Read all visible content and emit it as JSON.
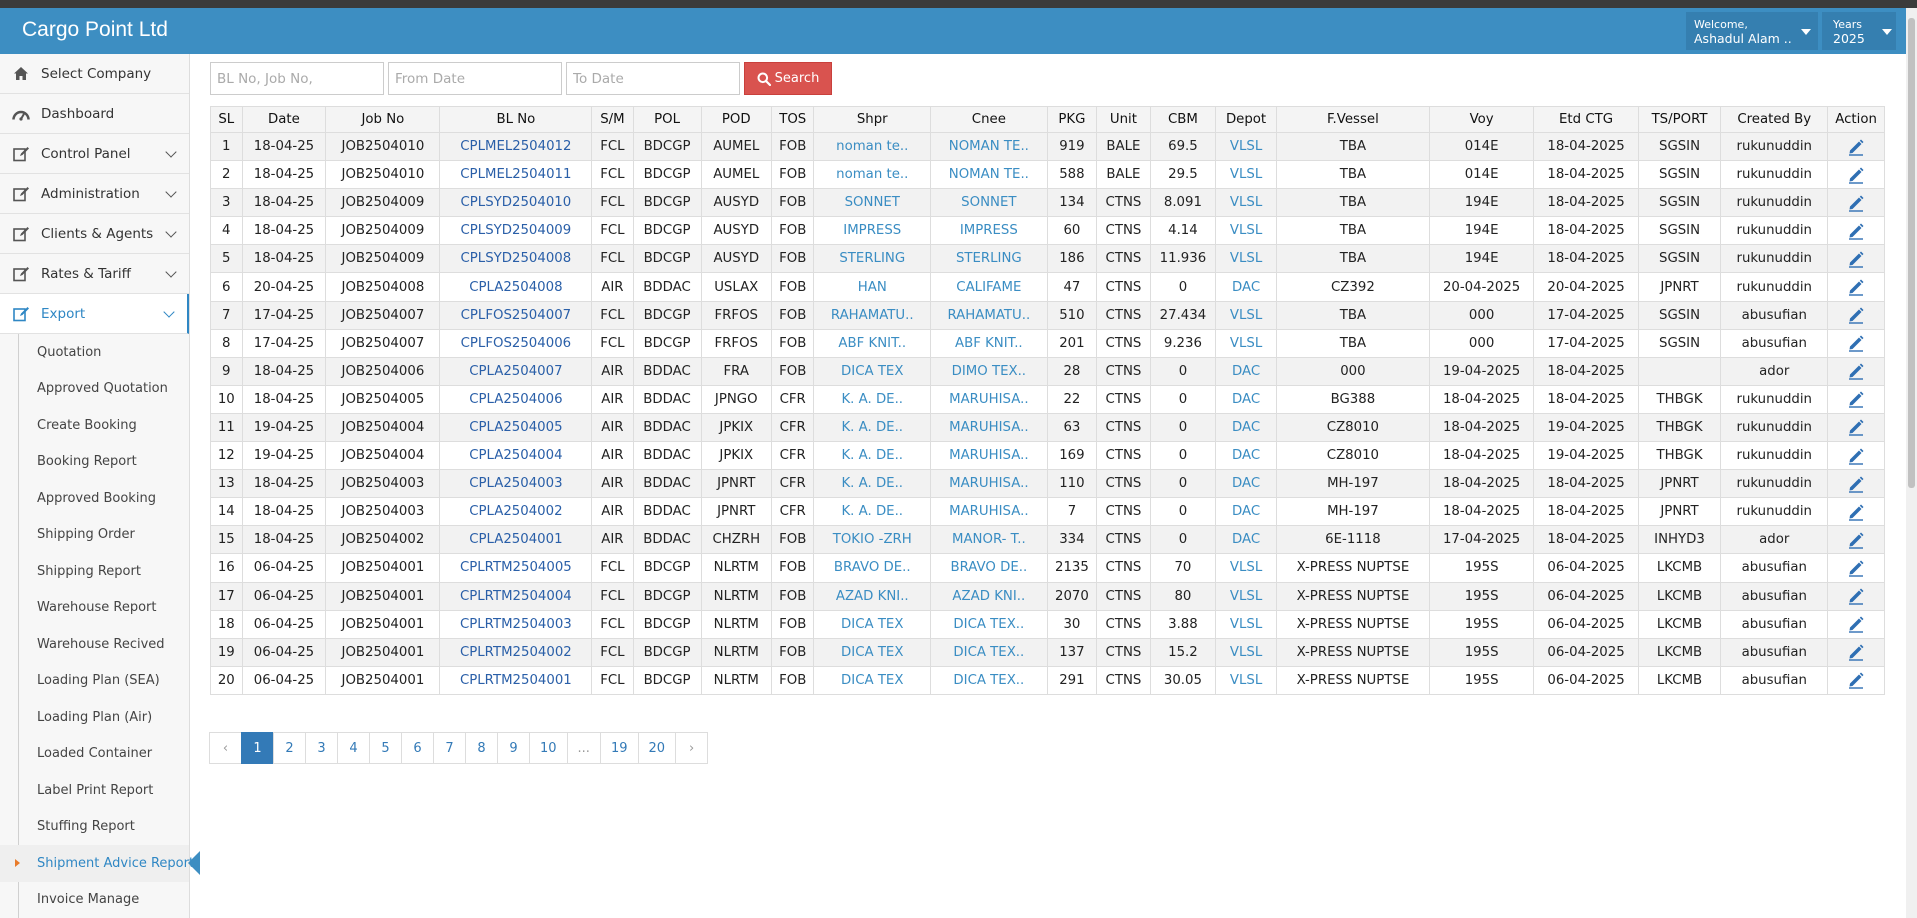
{
  "header": {
    "brand": "Cargo Point Ltd",
    "welcome_label": "Welcome,",
    "user_name": "Ashadul Alam ...",
    "years_label": "Years",
    "year_value": "2025"
  },
  "sidebar": {
    "items": [
      {
        "label": "Select Company",
        "icon": "home-icon",
        "chevron": false
      },
      {
        "label": "Dashboard",
        "icon": "dashboard-icon",
        "chevron": false
      },
      {
        "label": "Control Panel",
        "icon": "edit-icon",
        "chevron": true
      },
      {
        "label": "Administration",
        "icon": "edit-icon",
        "chevron": true
      },
      {
        "label": "Clients & Agents",
        "icon": "edit-icon",
        "chevron": true
      },
      {
        "label": "Rates & Tariff",
        "icon": "edit-icon",
        "chevron": true
      },
      {
        "label": "Export",
        "icon": "edit-icon",
        "chevron": true,
        "active": true
      }
    ],
    "export_submenu": [
      "Quotation",
      "Approved Quotation",
      "Create Booking",
      "Booking Report",
      "Approved Booking",
      "Shipping Order",
      "Shipping Report",
      "Warehouse Report",
      "Warehouse Recived",
      "Loading Plan (SEA)",
      "Loading Plan (Air)",
      "Loaded Container",
      "Label Print Report",
      "Stuffing Report",
      "Shipment Advice Report",
      "Invoice Manage"
    ],
    "current_submenu_index": 14
  },
  "filters": {
    "bl_placeholder": "BL No, Job No,",
    "from_placeholder": "From Date",
    "to_placeholder": "To Date",
    "search_label": "Search"
  },
  "table": {
    "columns": [
      "SL",
      "Date",
      "Job No",
      "BL No",
      "S/M",
      "POL",
      "POD",
      "TOS",
      "Shpr",
      "Cnee",
      "PKG",
      "Unit",
      "CBM",
      "Depot",
      "F.Vessel",
      "Voy",
      "Etd CTG",
      "TS/PORT",
      "Created By",
      "Action"
    ],
    "rows": [
      [
        "1",
        "18-04-25",
        "JOB2504010",
        "CPLMEL2504012",
        "FCL",
        "BDCGP",
        "AUMEL",
        "FOB",
        "noman te..",
        "NOMAN TE..",
        "919",
        "BALE",
        "69.5",
        "VLSL",
        "TBA",
        "014E",
        "18-04-2025",
        "SGSIN",
        "rukunuddin"
      ],
      [
        "2",
        "18-04-25",
        "JOB2504010",
        "CPLMEL2504011",
        "FCL",
        "BDCGP",
        "AUMEL",
        "FOB",
        "noman te..",
        "NOMAN TE..",
        "588",
        "BALE",
        "29.5",
        "VLSL",
        "TBA",
        "014E",
        "18-04-2025",
        "SGSIN",
        "rukunuddin"
      ],
      [
        "3",
        "18-04-25",
        "JOB2504009",
        "CPLSYD2504010",
        "FCL",
        "BDCGP",
        "AUSYD",
        "FOB",
        "SONNET",
        "SONNET",
        "134",
        "CTNS",
        "8.091",
        "VLSL",
        "TBA",
        "194E",
        "18-04-2025",
        "SGSIN",
        "rukunuddin"
      ],
      [
        "4",
        "18-04-25",
        "JOB2504009",
        "CPLSYD2504009",
        "FCL",
        "BDCGP",
        "AUSYD",
        "FOB",
        "IMPRESS",
        "IMPRESS",
        "60",
        "CTNS",
        "4.14",
        "VLSL",
        "TBA",
        "194E",
        "18-04-2025",
        "SGSIN",
        "rukunuddin"
      ],
      [
        "5",
        "18-04-25",
        "JOB2504009",
        "CPLSYD2504008",
        "FCL",
        "BDCGP",
        "AUSYD",
        "FOB",
        "STERLING",
        "STERLING",
        "186",
        "CTNS",
        "11.936",
        "VLSL",
        "TBA",
        "194E",
        "18-04-2025",
        "SGSIN",
        "rukunuddin"
      ],
      [
        "6",
        "20-04-25",
        "JOB2504008",
        "CPLA2504008",
        "AIR",
        "BDDAC",
        "USLAX",
        "FOB",
        "HAN",
        "CALIFAME",
        "47",
        "CTNS",
        "0",
        "DAC",
        "CZ392",
        "20-04-2025",
        "20-04-2025",
        "JPNRT",
        "rukunuddin"
      ],
      [
        "7",
        "17-04-25",
        "JOB2504007",
        "CPLFOS2504007",
        "FCL",
        "BDCGP",
        "FRFOS",
        "FOB",
        "RAHAMATU..",
        "RAHAMATU..",
        "510",
        "CTNS",
        "27.434",
        "VLSL",
        "TBA",
        "000",
        "17-04-2025",
        "SGSIN",
        "abusufian"
      ],
      [
        "8",
        "17-04-25",
        "JOB2504007",
        "CPLFOS2504006",
        "FCL",
        "BDCGP",
        "FRFOS",
        "FOB",
        "ABF KNIT..",
        "ABF KNIT..",
        "201",
        "CTNS",
        "9.236",
        "VLSL",
        "TBA",
        "000",
        "17-04-2025",
        "SGSIN",
        "abusufian"
      ],
      [
        "9",
        "18-04-25",
        "JOB2504006",
        "CPLA2504007",
        "AIR",
        "BDDAC",
        "FRA",
        "FOB",
        "DICA TEX",
        "DIMO TEX..",
        "28",
        "CTNS",
        "0",
        "DAC",
        "000",
        "19-04-2025",
        "18-04-2025",
        "",
        "ador"
      ],
      [
        "10",
        "18-04-25",
        "JOB2504005",
        "CPLA2504006",
        "AIR",
        "BDDAC",
        "JPNGO",
        "CFR",
        "K. A. DE..",
        "MARUHISA..",
        "22",
        "CTNS",
        "0",
        "DAC",
        "BG388",
        "18-04-2025",
        "18-04-2025",
        "THBGK",
        "rukunuddin"
      ],
      [
        "11",
        "19-04-25",
        "JOB2504004",
        "CPLA2504005",
        "AIR",
        "BDDAC",
        "JPKIX",
        "CFR",
        "K. A. DE..",
        "MARUHISA..",
        "63",
        "CTNS",
        "0",
        "DAC",
        "CZ8010",
        "18-04-2025",
        "19-04-2025",
        "THBGK",
        "rukunuddin"
      ],
      [
        "12",
        "19-04-25",
        "JOB2504004",
        "CPLA2504004",
        "AIR",
        "BDDAC",
        "JPKIX",
        "CFR",
        "K. A. DE..",
        "MARUHISA..",
        "169",
        "CTNS",
        "0",
        "DAC",
        "CZ8010",
        "18-04-2025",
        "19-04-2025",
        "THBGK",
        "rukunuddin"
      ],
      [
        "13",
        "18-04-25",
        "JOB2504003",
        "CPLA2504003",
        "AIR",
        "BDDAC",
        "JPNRT",
        "CFR",
        "K. A. DE..",
        "MARUHISA..",
        "110",
        "CTNS",
        "0",
        "DAC",
        "MH-197",
        "18-04-2025",
        "18-04-2025",
        "JPNRT",
        "rukunuddin"
      ],
      [
        "14",
        "18-04-25",
        "JOB2504003",
        "CPLA2504002",
        "AIR",
        "BDDAC",
        "JPNRT",
        "CFR",
        "K. A. DE..",
        "MARUHISA..",
        "7",
        "CTNS",
        "0",
        "DAC",
        "MH-197",
        "18-04-2025",
        "18-04-2025",
        "JPNRT",
        "rukunuddin"
      ],
      [
        "15",
        "18-04-25",
        "JOB2504002",
        "CPLA2504001",
        "AIR",
        "BDDAC",
        "CHZRH",
        "FOB",
        "TOKIO -ZRH",
        "MANOR- T..",
        "334",
        "CTNS",
        "0",
        "DAC",
        "6E-1118",
        "17-04-2025",
        "18-04-2025",
        "INHYD3",
        "ador"
      ],
      [
        "16",
        "06-04-25",
        "JOB2504001",
        "CPLRTM2504005",
        "FCL",
        "BDCGP",
        "NLRTM",
        "FOB",
        "BRAVO DE..",
        "BRAVO DE..",
        "2135",
        "CTNS",
        "70",
        "VLSL",
        "X-PRESS NUPTSE",
        "195S",
        "06-04-2025",
        "LKCMB",
        "abusufian"
      ],
      [
        "17",
        "06-04-25",
        "JOB2504001",
        "CPLRTM2504004",
        "FCL",
        "BDCGP",
        "NLRTM",
        "FOB",
        "AZAD KNI..",
        "AZAD KNI..",
        "2070",
        "CTNS",
        "80",
        "VLSL",
        "X-PRESS NUPTSE",
        "195S",
        "06-04-2025",
        "LKCMB",
        "abusufian"
      ],
      [
        "18",
        "06-04-25",
        "JOB2504001",
        "CPLRTM2504003",
        "FCL",
        "BDCGP",
        "NLRTM",
        "FOB",
        "DICA TEX",
        "DICA TEX..",
        "30",
        "CTNS",
        "3.88",
        "VLSL",
        "X-PRESS NUPTSE",
        "195S",
        "06-04-2025",
        "LKCMB",
        "abusufian"
      ],
      [
        "19",
        "06-04-25",
        "JOB2504001",
        "CPLRTM2504002",
        "FCL",
        "BDCGP",
        "NLRTM",
        "FOB",
        "DICA TEX",
        "DICA TEX..",
        "137",
        "CTNS",
        "15.2",
        "VLSL",
        "X-PRESS NUPTSE",
        "195S",
        "06-04-2025",
        "LKCMB",
        "abusufian"
      ],
      [
        "20",
        "06-04-25",
        "JOB2504001",
        "CPLRTM2504001",
        "FCL",
        "BDCGP",
        "NLRTM",
        "FOB",
        "DICA TEX",
        "DICA TEX..",
        "291",
        "CTNS",
        "30.05",
        "VLSL",
        "X-PRESS NUPTSE",
        "195S",
        "06-04-2025",
        "LKCMB",
        "abusufian"
      ]
    ]
  },
  "pagination": {
    "prev": "‹",
    "pages": [
      "1",
      "2",
      "3",
      "4",
      "5",
      "6",
      "7",
      "8",
      "9",
      "10",
      "...",
      "19",
      "20"
    ],
    "next": "›",
    "current": "1"
  },
  "colors": {
    "header_bg": "#3d8ec2",
    "link_blue": "#3a8dc3",
    "search_red": "#d9534f",
    "pager_active": "#337ab7"
  }
}
